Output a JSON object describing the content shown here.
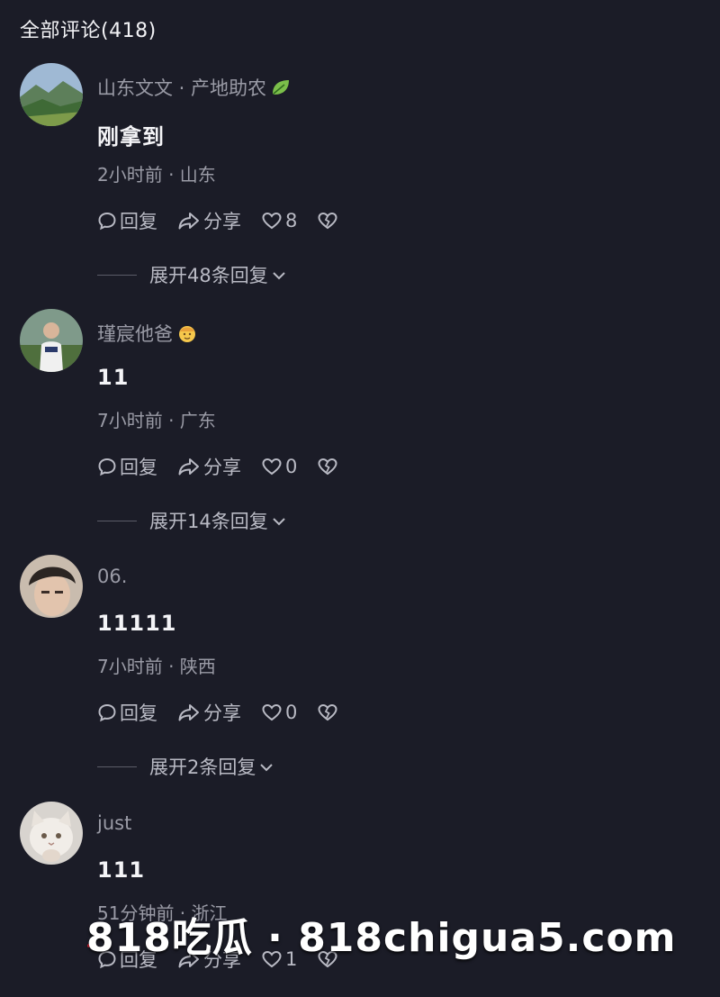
{
  "header": {
    "title": "全部评论(418)"
  },
  "actions_labels": {
    "reply": "回复",
    "share": "分享"
  },
  "comments": [
    {
      "username": "山东文文 · 产地助农",
      "badge_icon": "leaf-icon",
      "text": "刚拿到",
      "meta": "2小时前 · 山东",
      "likes": "8",
      "expand": "展开48条回复"
    },
    {
      "username": "瑾宸他爸",
      "badge_icon": "face-emoji-icon",
      "text": "11",
      "meta": "7小时前 · 广东",
      "likes": "0",
      "expand": "展开14条回复"
    },
    {
      "username": "06.",
      "text": "11111",
      "meta": "7小时前 · 陕西",
      "likes": "0",
      "expand": "展开2条回复"
    },
    {
      "username": "just",
      "text": "111",
      "meta": "51分钟前 · 浙江",
      "likes": "1"
    }
  ],
  "watermark": {
    "text": "818吃瓜 · 818chigua5.com"
  },
  "colors": {
    "background": "#1b1c27",
    "text_primary": "#f4f4f7",
    "text_secondary": "#9a9ba6"
  }
}
